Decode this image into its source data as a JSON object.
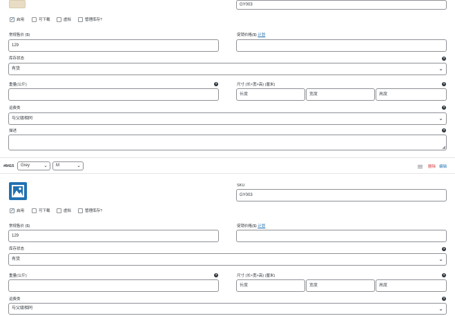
{
  "variation1": {
    "sku_value": "GY003",
    "checkboxes": [
      {
        "label": "启用",
        "checked": true
      },
      {
        "label": "可下载",
        "checked": false
      },
      {
        "label": "虚拟",
        "checked": false
      },
      {
        "label": "管理库存?",
        "checked": false
      }
    ],
    "regular_price_label": "常规售价 ($)",
    "regular_price_value": "129",
    "sale_price_label": "促销价格($)",
    "schedule_link": "计划",
    "stock_status_label": "库存状态",
    "stock_status_value": "有货",
    "weight_label": "重量(公斤)",
    "dimensions_label": "尺寸 (长×宽×高) (厘米)",
    "length_placeholder": "长度",
    "width_placeholder": "宽度",
    "height_placeholder": "高度",
    "shipping_class_label": "运费类",
    "shipping_class_value": "与父级相同",
    "description_label": "描述"
  },
  "variation2": {
    "id_label": "#8415",
    "color_value": "Grey",
    "size_value": "M",
    "menu_icon": "hamburger-icon",
    "remove_link": "删除",
    "edit_link": "编辑",
    "image_icon": "image-placeholder-icon",
    "sku_label": "SKU",
    "sku_value": "GY003",
    "checkboxes": [
      {
        "label": "启用",
        "checked": true
      },
      {
        "label": "可下载",
        "checked": false
      },
      {
        "label": "虚拟",
        "checked": false
      },
      {
        "label": "管理库存?",
        "checked": false
      }
    ],
    "regular_price_label": "常规售价 ($)",
    "regular_price_value": "129",
    "sale_price_label": "促销价格($)",
    "schedule_link": "计划",
    "stock_status_label": "库存状态",
    "stock_status_value": "有货",
    "weight_label": "重量(公斤)",
    "dimensions_label": "尺寸 (长×宽×高) (厘米)",
    "length_placeholder": "长度",
    "width_placeholder": "宽度",
    "height_placeholder": "高度",
    "shipping_class_label": "运费类",
    "shipping_class_value": "与父级相同"
  },
  "help_icon": "?",
  "chevron": "⌄",
  "colors": {
    "link": "#2271b1",
    "remove": "#d63638",
    "border": "#8c8f94",
    "thumb_bg": "#2271b1"
  }
}
